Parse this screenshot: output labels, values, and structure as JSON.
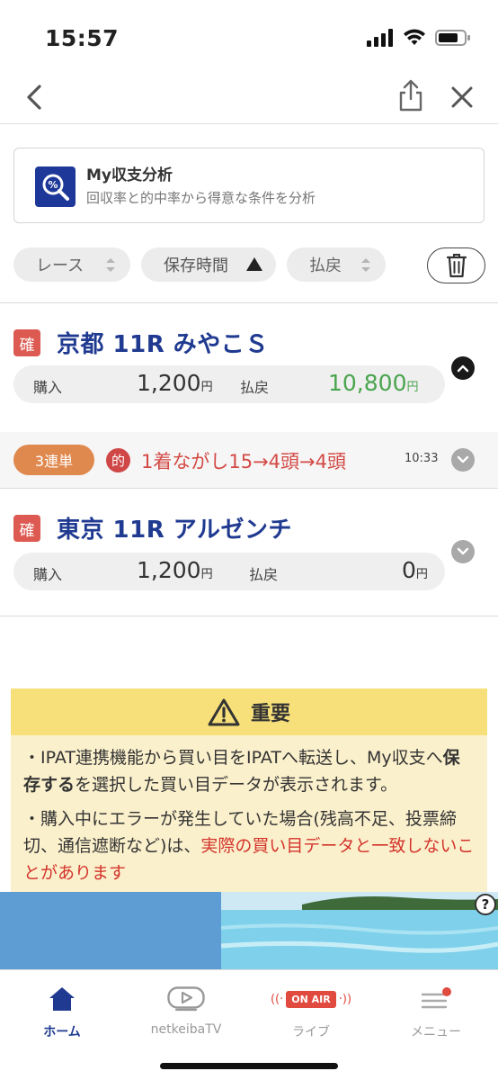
{
  "status": {
    "time": "15:57"
  },
  "analysis": {
    "title": "My収支分析",
    "subtitle": "回収率と的中率から得意な条件を分析"
  },
  "filters": {
    "race": "レース",
    "saved_time": "保存時間",
    "payout": "払戻"
  },
  "races": [
    {
      "badge": "確",
      "title": "京都 11R みやこＳ",
      "purchase_label": "購入",
      "purchase_amount": "1,200",
      "payout_label": "払戻",
      "payout_amount": "10,800",
      "yen": "円"
    },
    {
      "badge": "確",
      "title": "東京 11R アルゼンチ",
      "purchase_label": "購入",
      "purchase_amount": "1,200",
      "payout_label": "払戻",
      "payout_amount": "0",
      "yen": "円"
    }
  ],
  "bet": {
    "type": "3連単",
    "hit_badge": "的",
    "description": "1着ながし15→4頭→4頭",
    "time": "10:33"
  },
  "notice": {
    "title": "重要",
    "p1_a": "・IPAT連携機能から買い目をIPATへ転送し、My収支へ",
    "p1_bold": "保存する",
    "p1_b": "を選択した買い目データが表示されます。",
    "p2_a": "・購入中にエラーが発生していた場合(残高不足、投票締切、通信遮断など)は、",
    "p2_red": "実際の買い目データと一致しないことがあります"
  },
  "ad": {
    "help": "?"
  },
  "tabs": [
    {
      "label": "ホーム"
    },
    {
      "label": "netkeibaTV"
    },
    {
      "label": "ライブ",
      "badge": "ON AIR"
    },
    {
      "label": "メニュー"
    }
  ],
  "colors": {
    "accent": "#1f3a90",
    "profit": "#4aa54e",
    "hit": "#d34a45",
    "notice_bg": "#fbf0cc"
  }
}
